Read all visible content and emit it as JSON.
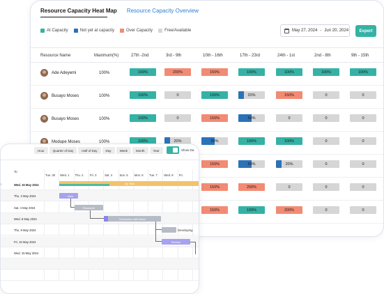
{
  "heatmap": {
    "tabs": {
      "active": "Resource Capacity Heat Map",
      "other": "Resource Capacity Overview"
    },
    "legend": [
      {
        "label": "At Capacity",
        "color": "#35b2a5"
      },
      {
        "label": "Not yet at capacity",
        "color": "#2c72b8"
      },
      {
        "label": "Over Capacity",
        "color": "#f28b73"
      },
      {
        "label": "Free/Available",
        "color": "#d6d6d6"
      }
    ],
    "date_range": {
      "start": "May 27, 2024",
      "separator": "-",
      "end": "Jun 20, 2024"
    },
    "export_label": "Export",
    "columns": {
      "name": "Resource Name",
      "max": "Maximum(%)",
      "weeks": [
        "27th -2nd",
        "3rd - 9th",
        "10th - 16th",
        "17th - 23rd",
        "24th - 1st",
        "2nd - 8th",
        "9th - 15th"
      ]
    },
    "rows": [
      {
        "name": "Ade Adeyemi",
        "max": "100%",
        "cells": [
          {
            "label": "100%",
            "type": "at",
            "pct": 100
          },
          {
            "label": "200%",
            "type": "over",
            "pct": 200
          },
          {
            "label": "150%",
            "type": "over",
            "pct": 150
          },
          {
            "label": "100%",
            "type": "at",
            "pct": 100
          },
          {
            "label": "100%",
            "type": "at",
            "pct": 100
          },
          {
            "label": "100%",
            "type": "at",
            "pct": 100
          },
          {
            "label": "100%",
            "type": "at",
            "pct": 100
          }
        ]
      },
      {
        "name": "Busayo Moses",
        "max": "100%",
        "cells": [
          {
            "label": "100%",
            "type": "at",
            "pct": 100
          },
          {
            "label": "0",
            "type": "free",
            "pct": 0
          },
          {
            "label": "100%",
            "type": "at",
            "pct": 100
          },
          {
            "label": "20%",
            "type": "part",
            "pct": 20
          },
          {
            "label": "150%",
            "type": "over",
            "pct": 150
          },
          {
            "label": "0",
            "type": "free",
            "pct": 0
          },
          {
            "label": "0",
            "type": "free",
            "pct": 0
          }
        ]
      },
      {
        "name": "Busayo Moses",
        "max": "100%",
        "cells": [
          {
            "label": "100%",
            "type": "at",
            "pct": 100
          },
          {
            "label": "0",
            "type": "free",
            "pct": 0
          },
          {
            "label": "150%",
            "type": "over",
            "pct": 150
          },
          {
            "label": "50%",
            "type": "part",
            "pct": 50
          },
          {
            "label": "0",
            "type": "free",
            "pct": 0
          },
          {
            "label": "0",
            "type": "free",
            "pct": 0
          },
          {
            "label": "0",
            "type": "free",
            "pct": 0
          }
        ]
      },
      {
        "name": "Modupe Moses",
        "max": "100%",
        "cells": [
          {
            "label": "100%",
            "type": "at",
            "pct": 100
          },
          {
            "label": "20%",
            "type": "part",
            "pct": 20
          },
          {
            "label": "50%",
            "type": "part",
            "pct": 50
          },
          {
            "label": "100%",
            "type": "at",
            "pct": 100
          },
          {
            "label": "100%",
            "type": "at",
            "pct": 100
          },
          {
            "label": "0",
            "type": "free",
            "pct": 0
          },
          {
            "label": "0",
            "type": "free",
            "pct": 0
          }
        ]
      },
      {
        "name": "",
        "max": "",
        "cells": [
          {
            "label": "",
            "type": "none",
            "pct": 0
          },
          {
            "label": "",
            "type": "none",
            "pct": 0
          },
          {
            "label": "150%",
            "type": "over",
            "pct": 150
          },
          {
            "label": "50%",
            "type": "part",
            "pct": 50
          },
          {
            "label": "20%",
            "type": "part",
            "pct": 20
          },
          {
            "label": "0",
            "type": "free",
            "pct": 0
          },
          {
            "label": "0",
            "type": "free",
            "pct": 0
          }
        ]
      },
      {
        "name": "",
        "max": "",
        "cells": [
          {
            "label": "",
            "type": "none",
            "pct": 0
          },
          {
            "label": "",
            "type": "none",
            "pct": 0
          },
          {
            "label": "150%",
            "type": "over",
            "pct": 150
          },
          {
            "label": "200%",
            "type": "over",
            "pct": 200
          },
          {
            "label": "0",
            "type": "free",
            "pct": 0
          },
          {
            "label": "0",
            "type": "free",
            "pct": 0
          },
          {
            "label": "0",
            "type": "free",
            "pct": 0
          }
        ]
      },
      {
        "name": "",
        "max": "",
        "cells": [
          {
            "label": "",
            "type": "none",
            "pct": 0
          },
          {
            "label": "",
            "type": "none",
            "pct": 0
          },
          {
            "label": "150%",
            "type": "over",
            "pct": 150
          },
          {
            "label": "100%",
            "type": "at",
            "pct": 100
          },
          {
            "label": "200%",
            "type": "over",
            "pct": 200
          },
          {
            "label": "0",
            "type": "free",
            "pct": 0
          },
          {
            "label": "0",
            "type": "free",
            "pct": 0
          }
        ]
      }
    ]
  },
  "gantt": {
    "toolbar": [
      "Hour",
      "Quarter of Day",
      "Half of Day",
      "Day",
      "Week",
      "Month",
      "Year"
    ],
    "toggle_label": "Show Da",
    "to_label": "To",
    "days": [
      "Tue. 30",
      "Wed. 1",
      "Thu. 2",
      "Fri. 3",
      "Sat. 4",
      "Sun. 5",
      "Mon. 6",
      "Tue. 7",
      "Wed. 8",
      "Fri."
    ],
    "rows": [
      {
        "label": "Wed. 15 May 2024",
        "bold": true
      },
      {
        "label": "Thu. 2 May 2024",
        "bold": false
      },
      {
        "label": "Sat. 4 May 2024",
        "bold": false
      },
      {
        "label": "Wed. 8 May 2024",
        "bold": false
      },
      {
        "label": "Thu. 9 May 2024",
        "bold": false
      },
      {
        "label": "Fri. 10 May 2024",
        "bold": false
      },
      {
        "label": "Wed. 15 May 2024",
        "bold": false
      }
    ],
    "tasks": {
      "summary": "Up Task",
      "idea": "Idea",
      "research": "Research",
      "discussion": "Discussion with team",
      "developing": "Developing",
      "review": "Review"
    }
  }
}
